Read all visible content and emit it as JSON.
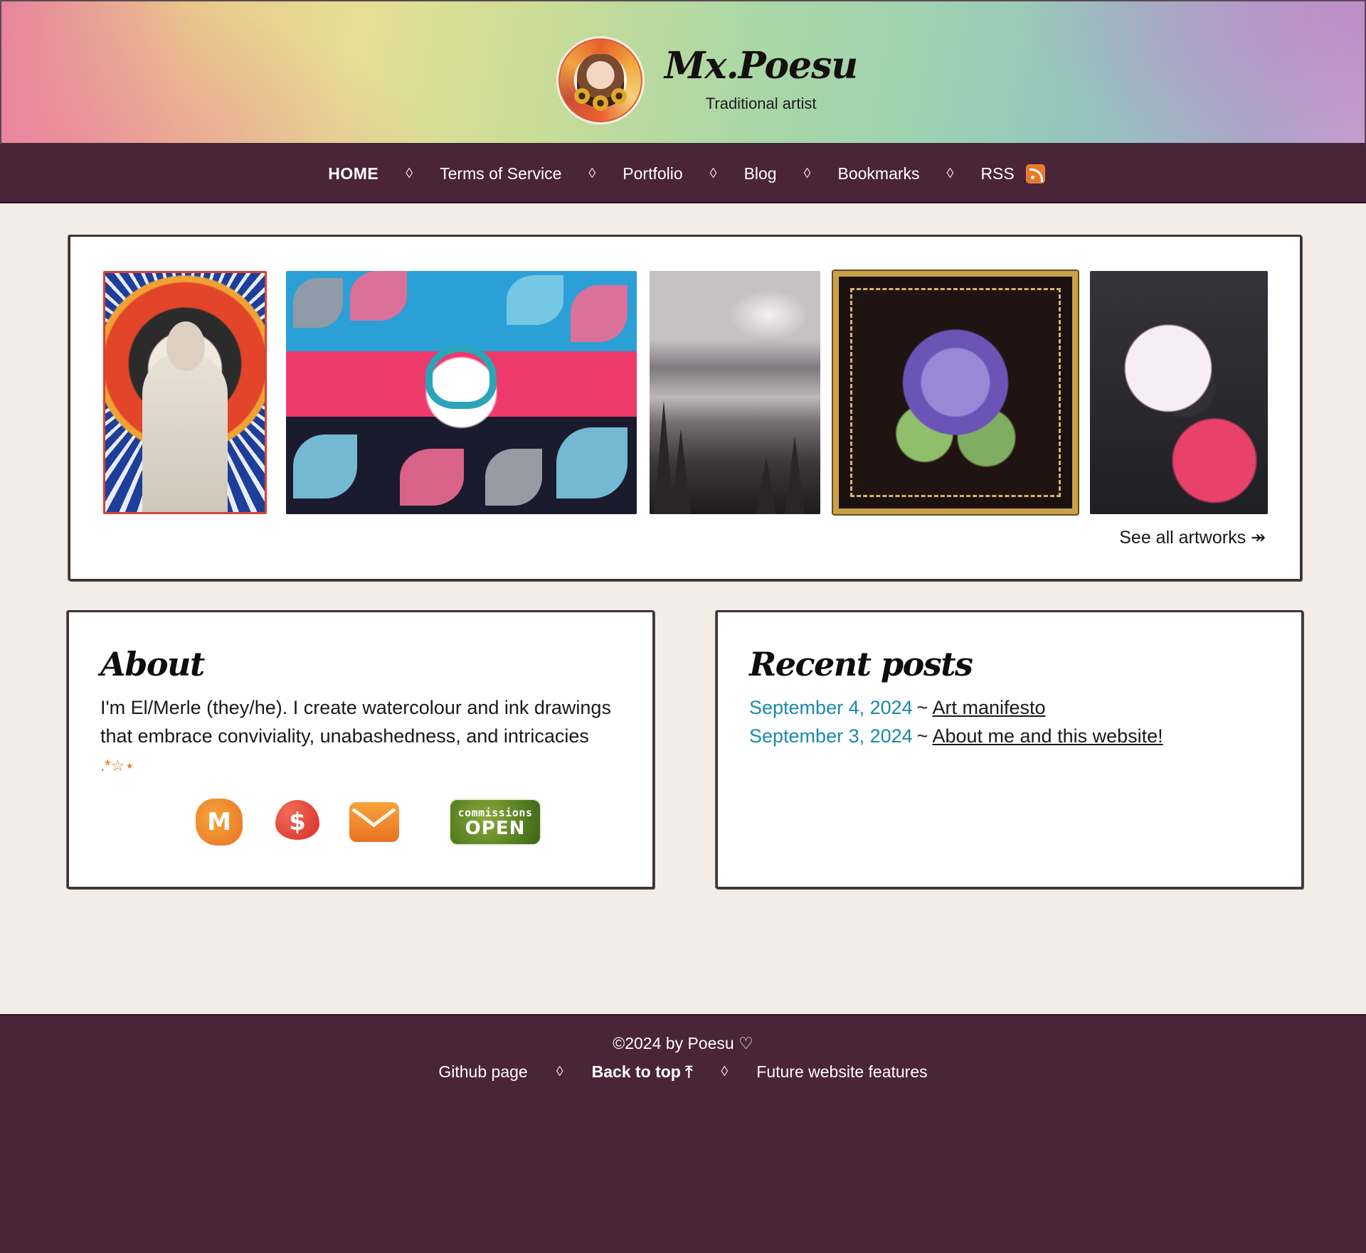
{
  "header": {
    "title": "Mx.Poesu",
    "subtitle": "Traditional artist"
  },
  "nav": {
    "items": [
      {
        "label": "HOME",
        "active": true
      },
      {
        "label": "Terms of Service"
      },
      {
        "label": "Portfolio"
      },
      {
        "label": "Blog"
      },
      {
        "label": "Bookmarks"
      },
      {
        "label": "RSS",
        "icon": "rss-icon"
      }
    ],
    "separator": "◊"
  },
  "gallery": {
    "artworks": [
      {
        "icon": "portrait-artwork"
      },
      {
        "icon": "heart-flowers-artwork"
      },
      {
        "icon": "landscape-artwork"
      },
      {
        "icon": "flower-frame-artwork"
      },
      {
        "icon": "creature-artwork"
      }
    ],
    "see_all_label": "See all artworks ↠"
  },
  "about": {
    "title": "About",
    "text": "I'm El/Merle (they/he). I create watercolour and ink drawings that embrace conviviality, unabashedness, and intricacies",
    "sparkle": ".*☆⋆",
    "social": [
      {
        "icon": "mastodon-icon",
        "glyph": "M"
      },
      {
        "icon": "donate-icon",
        "glyph": "$"
      },
      {
        "icon": "mail-icon"
      },
      {
        "icon": "commissions-badge",
        "line1": "commissions",
        "line2": "OPEN"
      }
    ]
  },
  "posts": {
    "title": "Recent posts",
    "items": [
      {
        "date": "September 4, 2024",
        "sep": "~",
        "title": "Art manifesto"
      },
      {
        "date": "September 3, 2024",
        "sep": "~",
        "title": "About me and this website!"
      }
    ]
  },
  "footer": {
    "copyright": "©2024 by Poesu ♡",
    "links": [
      {
        "label": "Github page"
      },
      {
        "label": "Back to top ⤒",
        "bold": true
      },
      {
        "label": "Future website features"
      }
    ],
    "separator": "◊"
  },
  "colors": {
    "nav_bg": "#4a2438",
    "page_bg": "#f4ede7",
    "date_link": "#1a8aaa",
    "accent_orange": "#e8792a"
  }
}
